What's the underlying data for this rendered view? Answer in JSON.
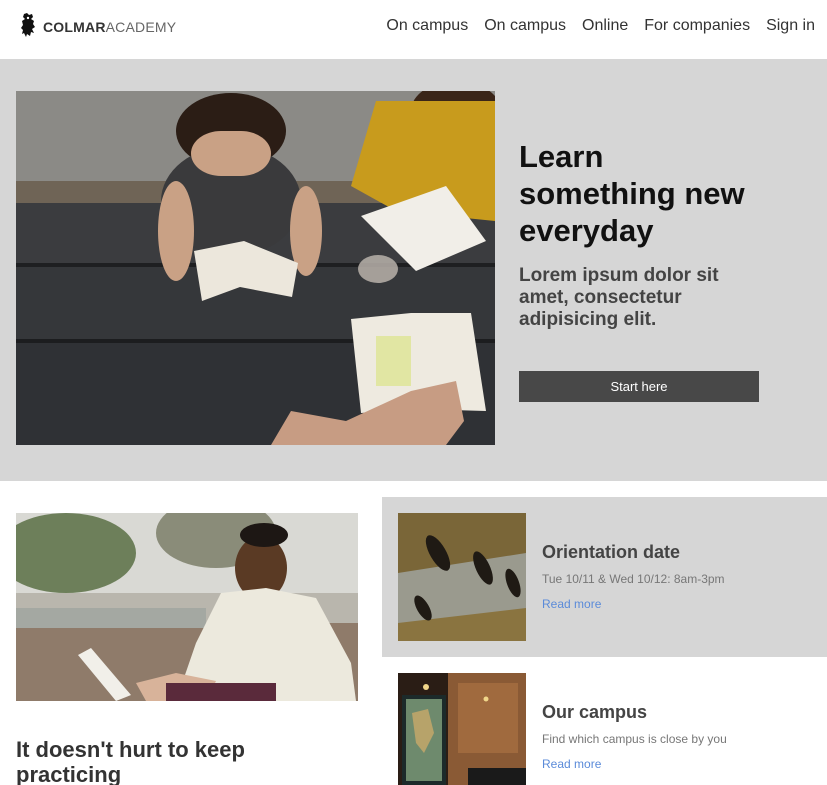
{
  "header": {
    "logo_bold": "COLMAR",
    "logo_light": "ACADEMY",
    "nav": [
      "On campus",
      "On campus",
      "Online",
      "For companies",
      "Sign in"
    ]
  },
  "hero": {
    "title": "Learn something new everyday",
    "subtitle": "Lorem ipsum dolor sit amet, consectetur adipisicing elit.",
    "button": "Start here"
  },
  "feature": {
    "title": "It doesn't hurt to keep practicing"
  },
  "events": [
    {
      "title": "Orientation date",
      "desc": "Tue 10/11 & Wed 10/12: 8am-3pm",
      "link": "Read more"
    },
    {
      "title": "Our campus",
      "desc": "Find which campus is close by you",
      "link": "Read more"
    }
  ],
  "colors": {
    "hero_bg": "#d6d6d6",
    "button_bg": "#484848",
    "link": "#5b8bd9"
  },
  "icons": [
    "lion-logo-icon"
  ]
}
